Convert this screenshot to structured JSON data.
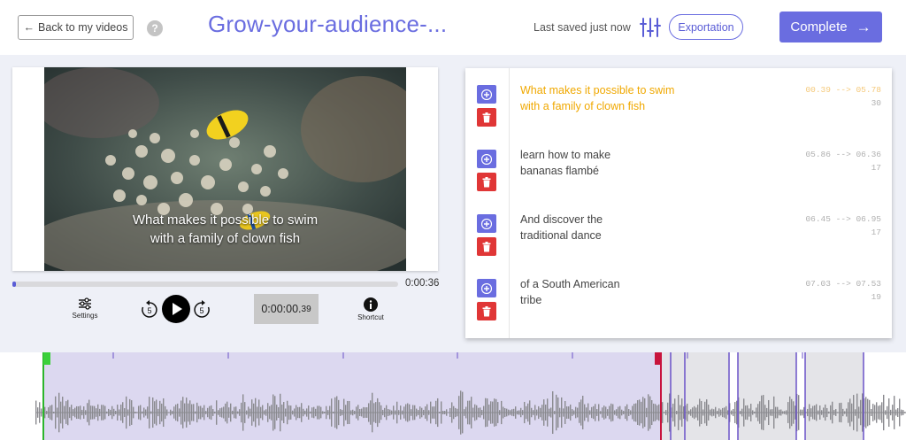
{
  "header": {
    "back_label": "Back to my videos",
    "help_icon": "question-circle-icon",
    "title": "Grow-your-audience-...",
    "saved_status": "Last saved just now",
    "sliders_icon": "sliders-icon",
    "export_label": "Exportation",
    "complete_label": "Complete",
    "accent_color": "#6a6de0"
  },
  "player": {
    "caption": [
      "What makes it possible to swim",
      "with a family of clown fish"
    ],
    "progress": 0.01,
    "duration": "0:00:36",
    "settings_label": "Settings",
    "rewind_seconds": "5",
    "forward_seconds": "5",
    "timecode_main": "0:00:00.",
    "timecode_ms": "39",
    "shortcut_label": "Shortcut"
  },
  "subtitles": [
    {
      "line1": "What makes it possible to swim",
      "line2": "with a family of clown fish",
      "start": "00.39",
      "end": "05.78",
      "chars": "30",
      "active": true
    },
    {
      "line1": "learn how to make",
      "line2": "bananas flambé",
      "start": "05.86",
      "end": "06.36",
      "chars": "17",
      "active": false
    },
    {
      "line1": "And discover the",
      "line2": "traditional dance",
      "start": "06.45",
      "end": "06.95",
      "chars": "17",
      "active": false
    },
    {
      "line1": "of a South American",
      "line2": "tribe",
      "start": "07.03",
      "end": "07.53",
      "chars": "19",
      "active": false
    }
  ],
  "colors": {
    "add": "#6a6de0",
    "delete": "#e03636",
    "active_text": "#f0a800",
    "segment_fill": "#dcd8f0",
    "segment_line": "#6a52c8",
    "playhead": "#3ad03a",
    "marker": "#c8143c"
  }
}
